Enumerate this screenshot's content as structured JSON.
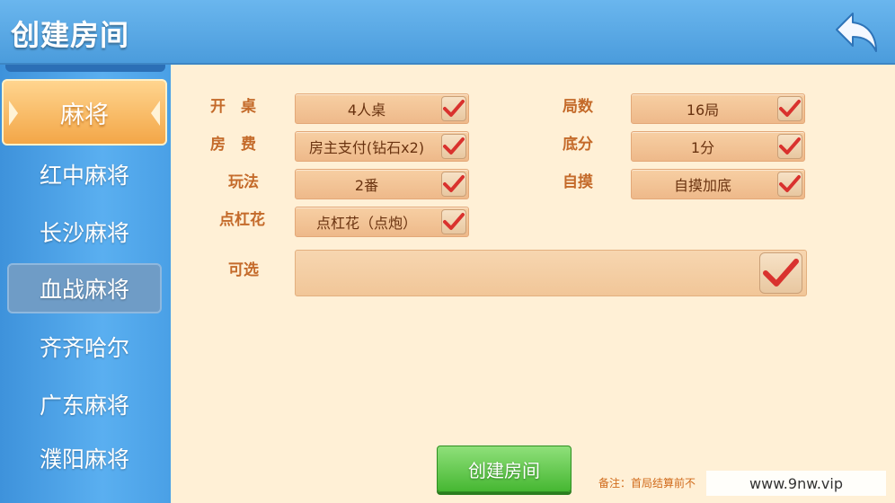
{
  "header": {
    "title": "创建房间",
    "back_icon": "back-arrow-icon"
  },
  "sidebar": {
    "items": [
      {
        "label": "麻将",
        "state": "active"
      },
      {
        "label": "红中麻将",
        "state": "normal"
      },
      {
        "label": "长沙麻将",
        "state": "normal"
      },
      {
        "label": "血战麻将",
        "state": "dim"
      },
      {
        "label": "齐齐哈尔",
        "state": "normal"
      },
      {
        "label": "广东麻将",
        "state": "normal"
      },
      {
        "label": "濮阳麻将",
        "state": "normal"
      }
    ]
  },
  "settings": {
    "table": {
      "label": "开　桌",
      "value": "4人桌",
      "checked": true
    },
    "fee": {
      "label": "房　费",
      "value": "房主支付(钻石x2)",
      "checked": true
    },
    "play": {
      "label": "玩法",
      "value": "2番",
      "checked": true
    },
    "kong": {
      "label": "点杠花",
      "value": "点杠花（点炮）",
      "checked": true
    },
    "rounds": {
      "label": "局数",
      "value": "16局",
      "checked": true
    },
    "base": {
      "label": "底分",
      "value": "1分",
      "checked": true
    },
    "selfdraw": {
      "label": "自摸",
      "value": "自摸加底",
      "checked": true
    },
    "optional": {
      "label": "可选",
      "checked": true
    }
  },
  "actions": {
    "create_label": "创建房间"
  },
  "note": "备注：首局结算前不",
  "watermark": "www.9nw.vip",
  "colors": {
    "header_blue": "#4b9cdc",
    "panel_bg": "#fff0d6",
    "label_orange": "#c46a2a",
    "check_red": "#d9322e",
    "button_green": "#46b732"
  }
}
